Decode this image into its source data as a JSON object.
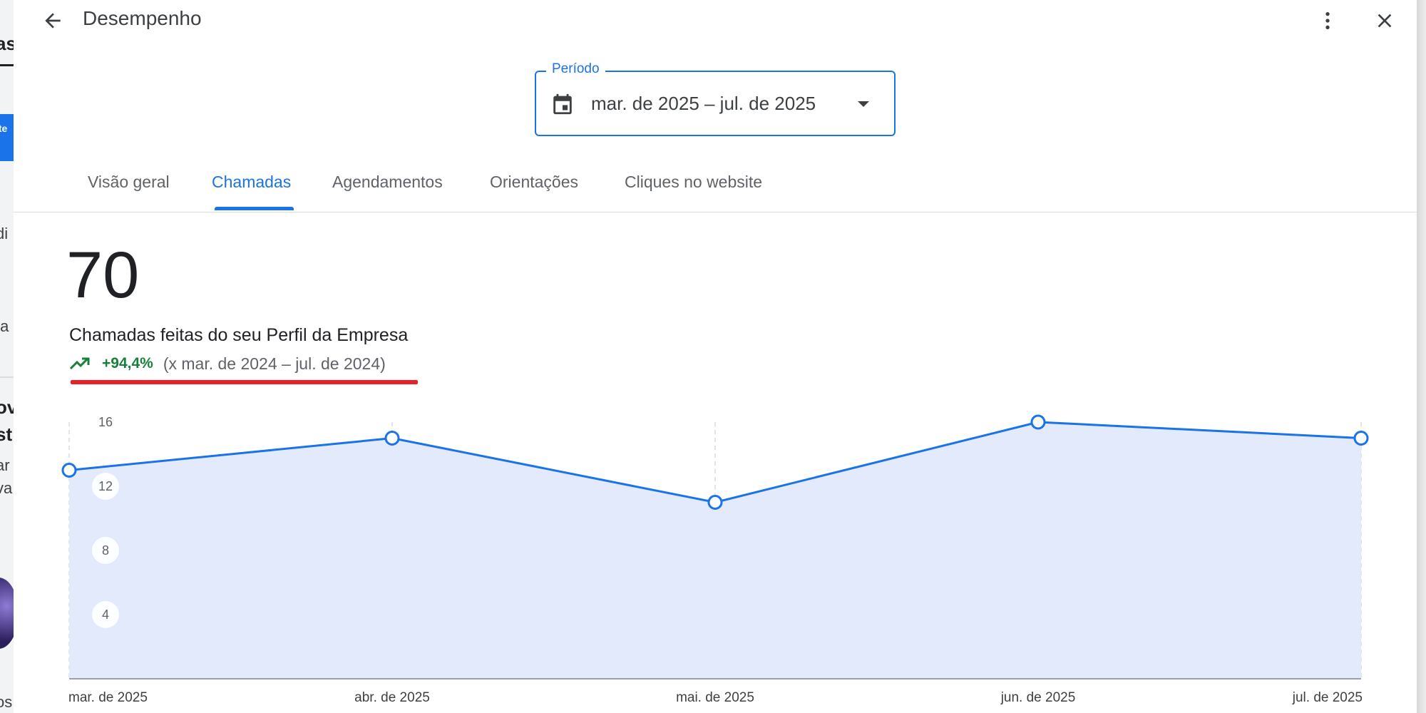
{
  "dialog": {
    "title": "Desempenho"
  },
  "period": {
    "label": "Período",
    "value": "mar. de 2025 – jul. de 2025"
  },
  "tabs": [
    {
      "label": "Visão geral",
      "active": false
    },
    {
      "label": "Chamadas",
      "active": true
    },
    {
      "label": "Agendamentos",
      "active": false
    },
    {
      "label": "Orientações",
      "active": false
    },
    {
      "label": "Cliques no website",
      "active": false
    }
  ],
  "metric": {
    "value": "70",
    "label": "Chamadas feitas do seu Perfil da Empresa",
    "trend_value": "+94,4%",
    "trend_compare": "(x mar. de 2024 – jul. de 2024)"
  },
  "background_page": {
    "fragments": [
      "as",
      "ite",
      "di",
      "ta",
      "ov",
      "st",
      "ar",
      "va",
      "os"
    ]
  },
  "colors": {
    "accent": "#1a73e8",
    "positive": "#188038",
    "highlight_underline": "#ea2127",
    "chart_fill": "#e2eafb"
  },
  "icons": {
    "back": "arrow-left-icon",
    "more": "more-vert-icon",
    "close": "close-icon",
    "calendar": "calendar-icon",
    "dropdown": "caret-down-icon",
    "trend": "trending-up-icon"
  },
  "chart_data": {
    "type": "area",
    "categories": [
      "mar. de 2025",
      "abr. de 2025",
      "mai. de 2025",
      "jun. de 2025",
      "jul. de 2025"
    ],
    "values": [
      13,
      15,
      11,
      16,
      15
    ],
    "yticks": [
      4,
      8,
      12,
      16
    ],
    "ylim": [
      0,
      16
    ],
    "grid": "vertical-dashed",
    "title": "",
    "xlabel": "",
    "ylabel": ""
  }
}
